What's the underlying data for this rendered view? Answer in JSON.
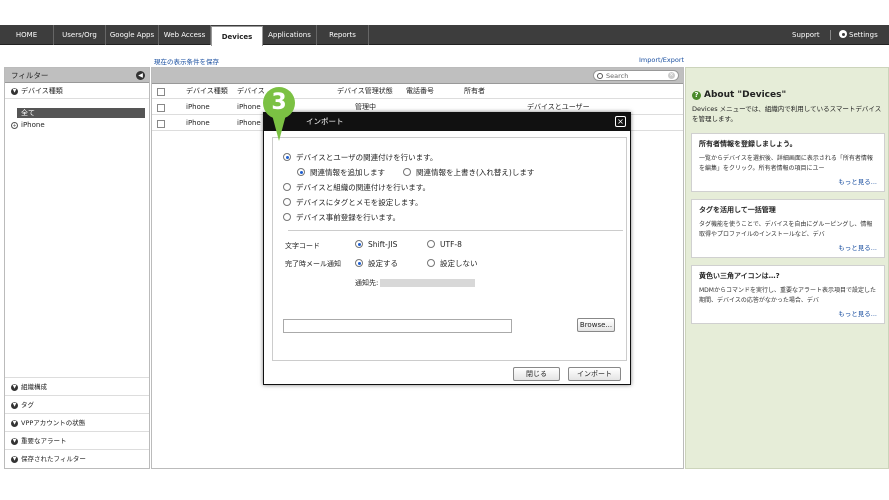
{
  "nav": {
    "items": [
      "HOME",
      "Users/Org",
      "Google Apps",
      "Web Access",
      "Devices",
      "Applications",
      "Reports"
    ],
    "active": "Devices",
    "support": "Support",
    "settings": "Settings"
  },
  "links": {
    "save_filter": "現在の表示条件を保存",
    "import_export": "Import/Export"
  },
  "sidebar": {
    "title": "フィルター",
    "section_device_type": "デバイス種類",
    "selected": "全て",
    "sub_iphone": "iPhone",
    "bottom": [
      "組織構成",
      "タグ",
      "VPPアカウントの状態",
      "重要なアラート",
      "保存されたフィルター"
    ]
  },
  "search": {
    "placeholder": "Search"
  },
  "table": {
    "headers": [
      "デバイス種類",
      "デバイス",
      "デバイス管理状態",
      "電話番号",
      "所有者"
    ],
    "rows": [
      {
        "type": "iPhone",
        "name": "iPhone",
        "status": "管理中",
        "extra": "デバイスとユーザー"
      },
      {
        "type": "iPhone",
        "name": "iPhone",
        "status": "",
        "extra": ""
      }
    ]
  },
  "dialog": {
    "title": "インポート",
    "close": "×",
    "options": [
      "デバイスとユーザの関連付けを行います。",
      "デバイスと組織の関連付けを行います。",
      "デバイスにタグとメモを設定します。",
      "デバイス事前登録を行います。"
    ],
    "sub_add": "関連情報を追加します",
    "sub_overwrite": "関連情報を上書き(入れ替え)します",
    "charset_label": "文字コード",
    "charset_sjis": "Shift-JIS",
    "charset_utf8": "UTF-8",
    "mail_label": "完了時メール通知",
    "mail_on": "設定する",
    "mail_off": "設定しない",
    "notify_to": "通知先:",
    "browse": "Browse...",
    "close_btn": "閉じる",
    "import_btn": "インポート"
  },
  "step": "3",
  "about": {
    "title": "About \"Devices\"",
    "intro": "Devices メニューでは、組織内で利用しているスマートデバイスを管理します。",
    "cards": [
      {
        "title": "所有者情報を登録しましょう。",
        "body": "一覧からデバイスを選択後、詳細画面に表示される「所有者情報を編集」をクリック。所有者情報の項目にユー",
        "more": "もっと見る..."
      },
      {
        "title": "タグを活用して一括管理",
        "body": "タグ機能を使うことで、デバイスを自由にグルーピングし、情報取得やプロファイルのインストールなど、デバ",
        "more": "もっと見る..."
      },
      {
        "title": "黄色い三角アイコンは…?",
        "body": "MDMからコマンドを実行し、重要なアラート表示項目で設定した期間、デバイスの応答がなかった場合、デバ",
        "more": "もっと見る..."
      }
    ]
  }
}
